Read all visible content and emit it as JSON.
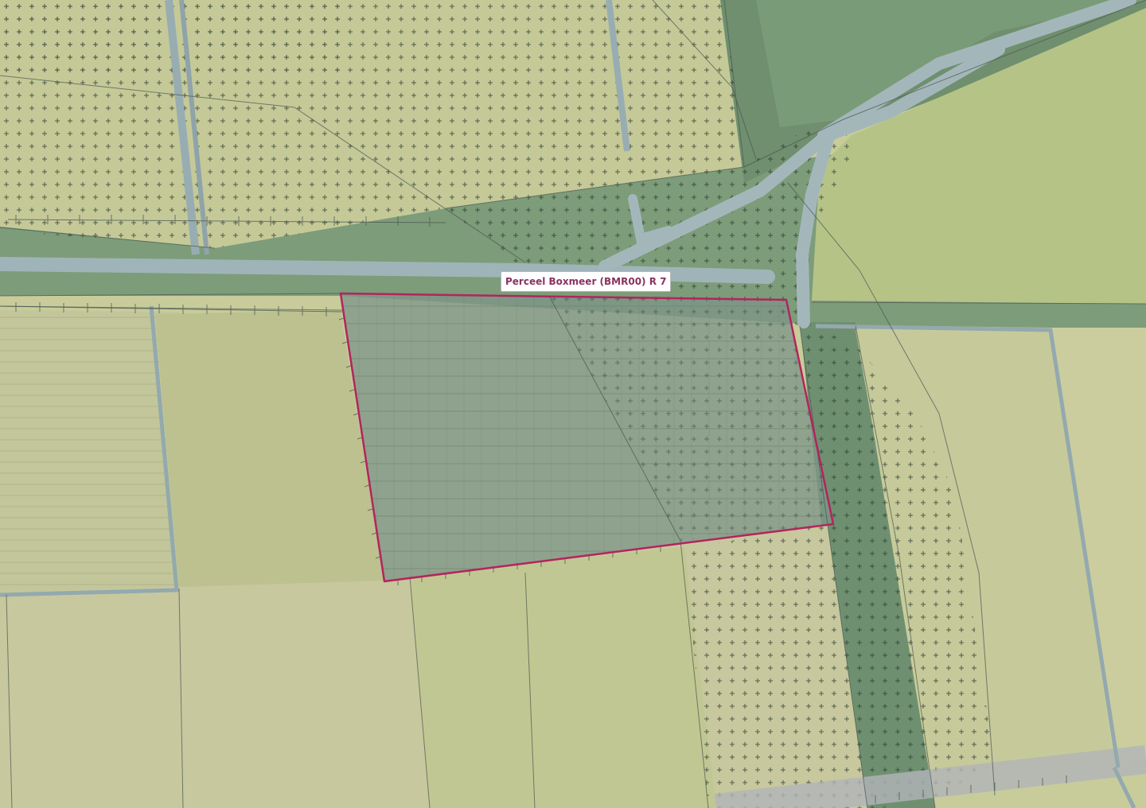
{
  "map": {
    "selected_parcel": {
      "label": "Perceel Boxmeer (BMR00) R 7",
      "outline_color": "#b3245e",
      "fill_color": "#7f9689"
    },
    "colors": {
      "farmland": "#c8cc9a",
      "woodland": "#7d9c79",
      "road": "#a3b7bb",
      "hatch_symbol": "#2b3a2f",
      "parcel_line": "#6f7c86"
    },
    "layers": {
      "cross_hatch_pattern": "plus-symbols",
      "boundary_ticks": "fence-line-ticks"
    }
  }
}
